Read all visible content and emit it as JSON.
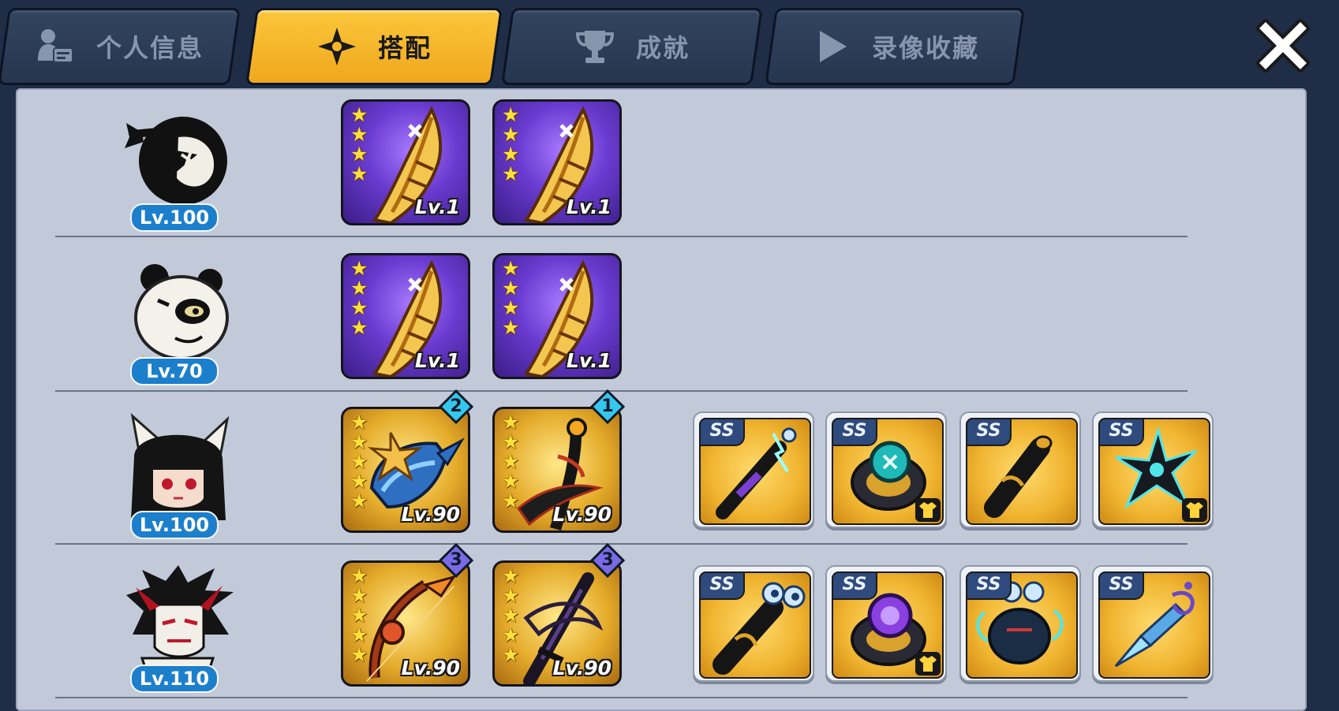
{
  "tabs": [
    {
      "label": "个人信息",
      "icon": "profile-card-icon",
      "active": false
    },
    {
      "label": "搭配",
      "icon": "shuriken-icon",
      "active": true
    },
    {
      "label": "成就",
      "icon": "trophy-icon",
      "active": false
    },
    {
      "label": "录像收藏",
      "icon": "play-icon",
      "active": false
    }
  ],
  "close_icon": "close-icon",
  "colors": {
    "active_tab": "#f6b52a",
    "inactive_tab": "#2d3d58",
    "panel_bg": "#c2cad9",
    "level_badge": "#1c7fcb",
    "star": "#ffe03a",
    "gem": "#35c8ee"
  },
  "rows": [
    {
      "character": "black-ninja",
      "level": "Lv.100",
      "weapons": [
        {
          "stars": 4,
          "level": "Lv.1",
          "frame": "purple",
          "item": "golden-scroll-icon"
        },
        {
          "stars": 4,
          "level": "Lv.1",
          "frame": "purple",
          "item": "golden-scroll-icon"
        }
      ],
      "gear": []
    },
    {
      "character": "panda",
      "level": "Lv.70",
      "weapons": [
        {
          "stars": 4,
          "level": "Lv.1",
          "frame": "purple",
          "item": "golden-scroll-icon"
        },
        {
          "stars": 4,
          "level": "Lv.1",
          "frame": "purple",
          "item": "golden-scroll-icon"
        }
      ],
      "gear": []
    },
    {
      "character": "fox-girl",
      "level": "Lv.100",
      "weapons": [
        {
          "stars": 5,
          "level": "Lv.90",
          "frame": "gold",
          "item": "shark-weapon-icon",
          "gem": "2"
        },
        {
          "stars": 5,
          "level": "Lv.90",
          "frame": "gold",
          "item": "dark-scythe-icon",
          "gem": "1"
        }
      ],
      "gear": [
        {
          "rank": "SS",
          "item": "lightning-scroll-icon",
          "shirt": false
        },
        {
          "rank": "SS",
          "item": "water-ring-icon",
          "shirt": true
        },
        {
          "rank": "SS",
          "item": "dark-scroll-icon",
          "shirt": false
        },
        {
          "rank": "SS",
          "item": "shuriken-icon",
          "shirt": true
        }
      ]
    },
    {
      "character": "oni-mask-ninja",
      "level": "Lv.110",
      "weapons": [
        {
          "stars": 5,
          "level": "Lv.90",
          "frame": "gold",
          "item": "fire-bow-icon",
          "gem": "3"
        },
        {
          "stars": 5,
          "level": "Lv.90",
          "frame": "gold",
          "item": "dark-katana-icon",
          "gem": "3"
        }
      ],
      "gear": [
        {
          "rank": "SS",
          "item": "eye-scroll-icon",
          "shirt": false
        },
        {
          "rank": "SS",
          "item": "purple-ring-icon",
          "shirt": true
        },
        {
          "rank": "SS",
          "item": "spirit-bomb-icon",
          "shirt": false
        },
        {
          "rank": "SS",
          "item": "ice-kunai-icon",
          "shirt": false
        }
      ]
    }
  ]
}
